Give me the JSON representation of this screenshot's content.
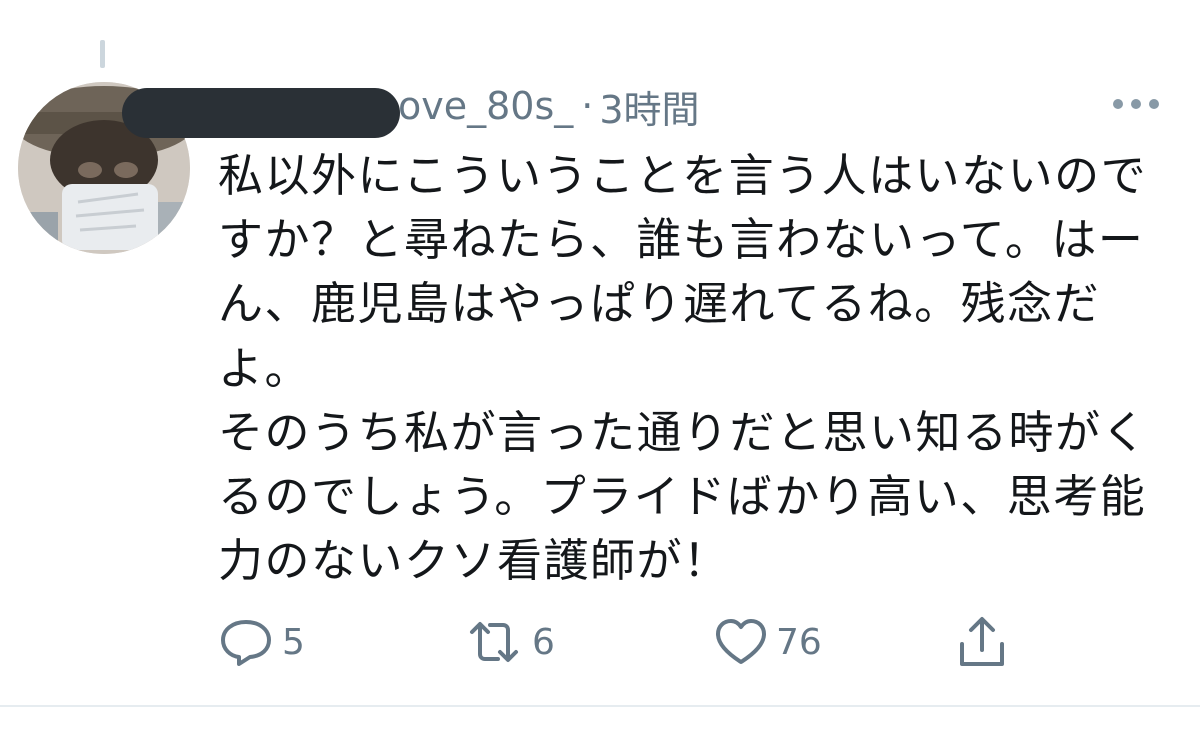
{
  "tweet": {
    "handle_visible": "ove_80s_",
    "separator": "·",
    "timestamp": "3時間",
    "text_lines": [
      "私以外にこういうことを言う人はいないので",
      "すか？と尋ねたら、誰も言わないって。はー",
      "ん、鹿児島はやっぱり遅れてるね。残念だ",
      "よ。",
      "そのうち私が言った通りだと思い知る時がく",
      "るのでしょう。プライドばかり高い、思考能",
      "力のないクソ看護師が！"
    ]
  },
  "actions": {
    "reply_count": "5",
    "retweet_count": "6",
    "like_count": "76"
  },
  "icons": {
    "more": "more-horizontal-icon",
    "reply": "reply-icon",
    "retweet": "retweet-icon",
    "like": "heart-icon",
    "share": "share-icon"
  },
  "colors": {
    "text": "#14171a",
    "secondary": "#657786",
    "redaction": "#2a3036",
    "divider": "#e6ecf0"
  }
}
